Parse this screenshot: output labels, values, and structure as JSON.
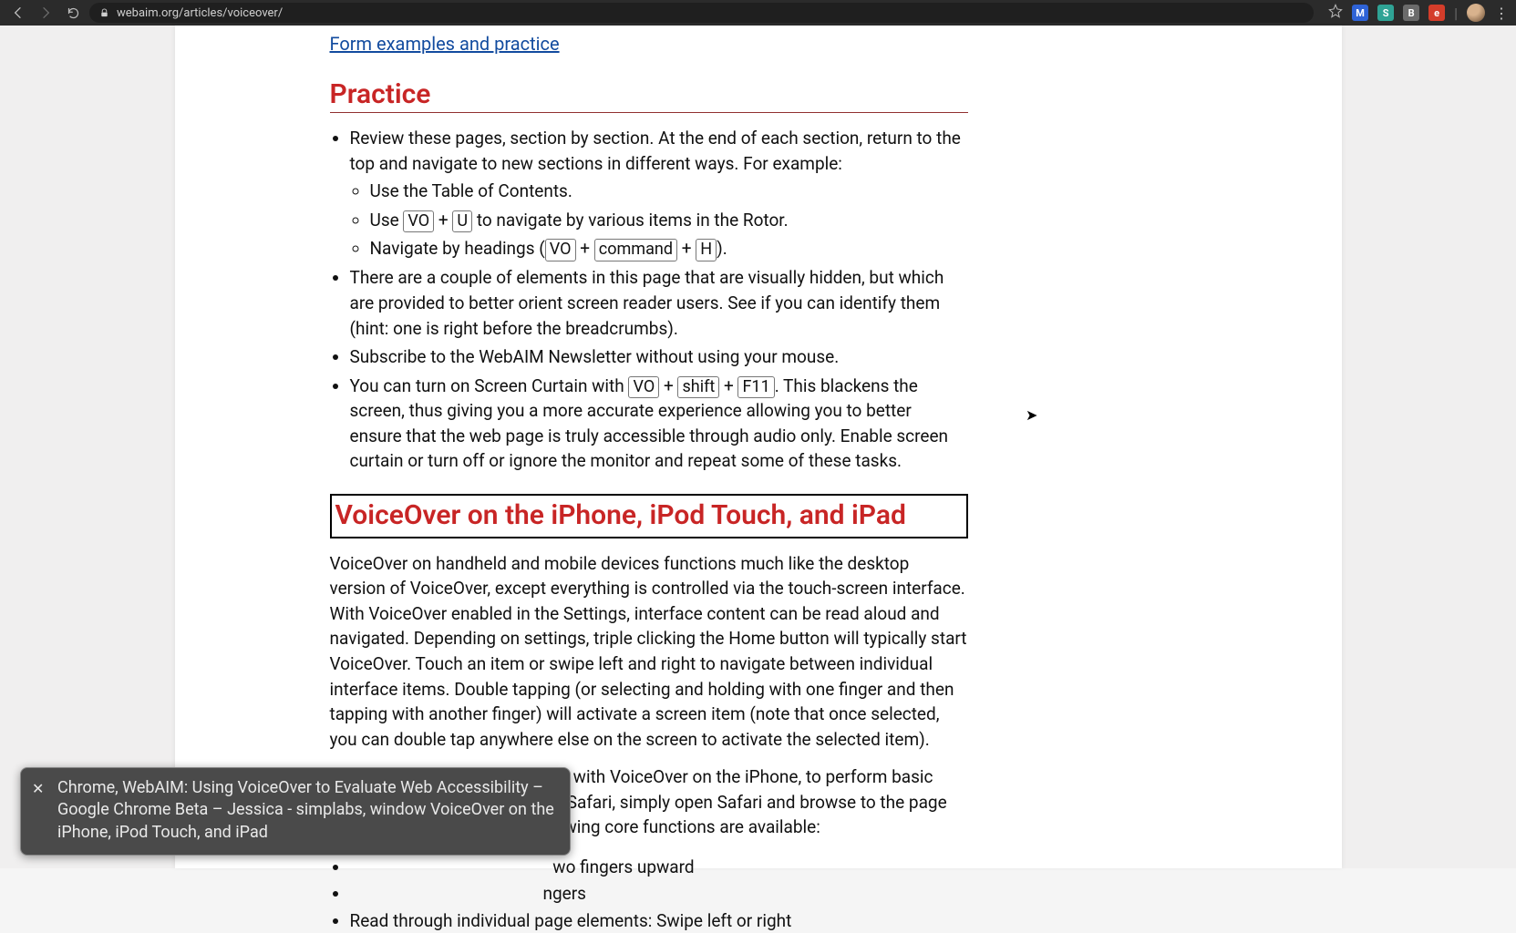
{
  "browser": {
    "url": "webaim.org/articles/voiceover/",
    "ext_badges": [
      "M",
      "S",
      "B",
      "e"
    ]
  },
  "link_form": "Form examples and practice",
  "heading_practice": "Practice",
  "bullets": {
    "review_a": "Review these pages, section by section. At the end of each section, return to the top and navigate to new sections in different ways. For example:",
    "toc": "Use the Table of Contents.",
    "rotor_a": "Use ",
    "rotor_vo": "VO",
    "rotor_plus": " + ",
    "rotor_u": "U",
    "rotor_b": " to navigate by various items in the Rotor.",
    "head_a": "Navigate by headings (",
    "head_vo": "VO",
    "head_plus1": " + ",
    "head_cmd": "command",
    "head_plus2": " + ",
    "head_h": "H",
    "head_b": ").",
    "hidden": "There are a couple of elements in this page that are visually hidden, but which are provided to better orient screen reader users. See if you can identify them (hint: one is right before the breadcrumbs).",
    "subscribe": "Subscribe to the WebAIM Newsletter without using your mouse.",
    "curtain_a": "You can turn on Screen Curtain with ",
    "curtain_vo": "VO",
    "curtain_p1": " + ",
    "curtain_shift": "shift",
    "curtain_p2": " + ",
    "curtain_f11": "F11",
    "curtain_b": ". This blackens the screen, thus giving you a more accurate experience allowing you to better ensure that the web page is truly accessible through audio only. Enable screen curtain or turn off or ignore the monitor and repeat some of these tasks."
  },
  "heading_mobile": "VoiceOver on the iPhone, iPod Touch, and iPad",
  "para1": "VoiceOver on handheld and mobile devices functions much like the desktop version of VoiceOver, except everything is controlled via the touch-screen interface. With VoiceOver enabled in the Settings, interface content can be read aloud and navigated. Depending on settings, triple clicking the Home button will typically start VoiceOver. Touch an item or swipe left and right to navigate between individual interface items. Double tapping (or selecting and holding with one finger and then tapping with another finger) will activate a screen item (note that once selected, you can double tap anywhere else on the screen to activate the selected item).",
  "para2": "While there is much you can do with VoiceOver on the iPhone, to perform basic web accessibility evaluation in Safari, simply open Safari and browse to the page you want to evaluate. The following core functions are available:",
  "mobile_fns": {
    "f1_vis": "wo fingers upward",
    "f2_vis": "ngers",
    "f3": "Read through individual page elements: Swipe left or right"
  },
  "caption": "Chrome, WebAIM: Using VoiceOver to Evaluate Web Accessibility – Google Chrome Beta – Jessica - simplabs, window VoiceOver on the iPhone, iPod Touch, and iPad"
}
